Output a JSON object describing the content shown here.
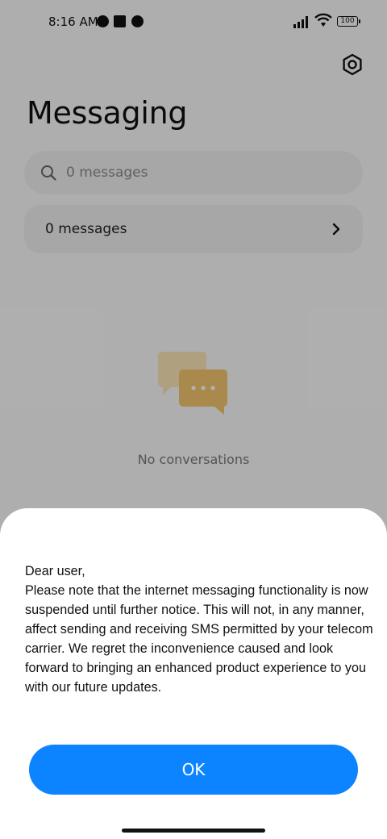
{
  "status_bar": {
    "time": "8:16 AM",
    "battery": "100"
  },
  "app": {
    "title": "Messaging",
    "search_placeholder": "0 messages",
    "messages_row_label": "0 messages",
    "empty_state_text": "No conversations"
  },
  "dialog": {
    "message": "Dear user,\nPlease note that the internet messaging functionality is now suspended until further notice. This will not, in any manner, affect sending and receiving SMS permitted by your telecom carrier. We regret the inconvenience caused and look forward to bringing an enhanced product experience to you with our future updates.",
    "ok_label": "OK"
  },
  "colors": {
    "accent": "#0d84ff",
    "illustration": "#f2c66d"
  },
  "icons": {
    "settings": "gear-icon",
    "search": "search-icon",
    "chevron": "chevron-right-icon",
    "empty": "chat-bubbles-icon"
  }
}
